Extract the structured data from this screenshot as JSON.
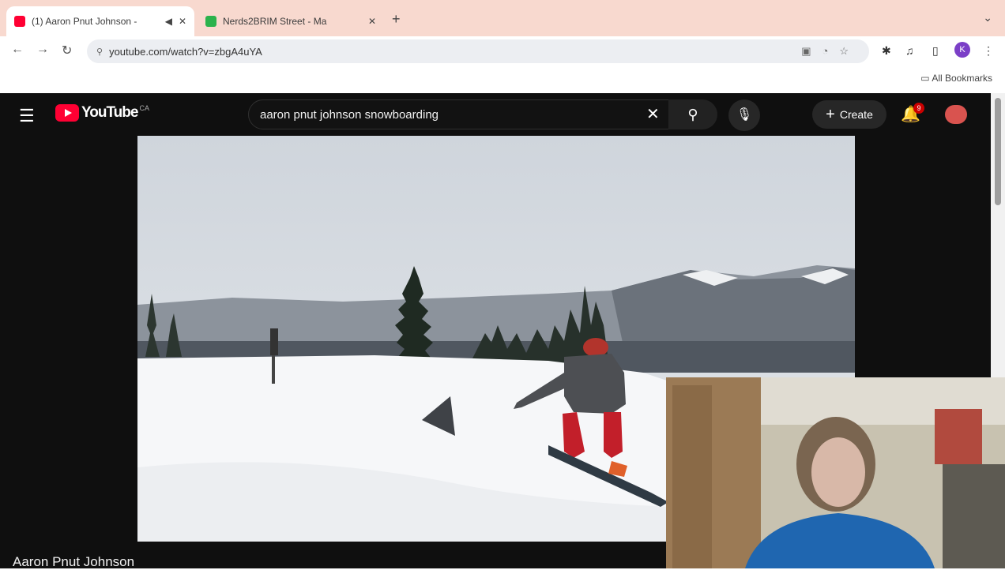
{
  "browser": {
    "tabs": [
      {
        "title": "(1) Aaron Pnut Johnson -",
        "active": true,
        "favicon_color": "#ff0033"
      },
      {
        "title": "Nerds2BRIM Street - Ma",
        "active": false,
        "favicon_color": "#2bb24c"
      }
    ],
    "url": "youtube.com/watch?v=zbgA4uYA",
    "bookmarks_label": "All Bookmarks",
    "profile_initial": "K"
  },
  "youtube": {
    "logo_text": "YouTube",
    "logo_country": "CA",
    "search_query": "aaron pnut johnson snowboarding",
    "create_label": "Create",
    "notification_count": "9",
    "video_title": "Aaron Pnut Johnson"
  },
  "icons": {
    "menu": "hamburger-icon",
    "search": "search-icon",
    "mic": "microphone-icon",
    "bell": "bell-icon",
    "clear": "close-icon"
  },
  "colors": {
    "tabstrip": "#f8d9cf",
    "yt_bg": "#0f0f0f",
    "yt_red": "#ff0033"
  }
}
